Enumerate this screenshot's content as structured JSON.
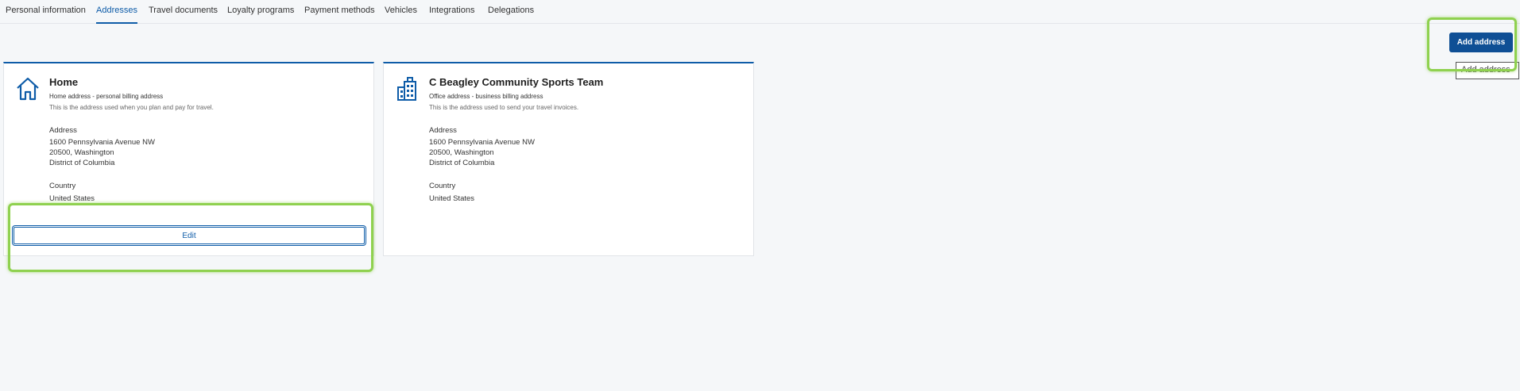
{
  "tabs": [
    {
      "label": "Personal information"
    },
    {
      "label": "Addresses",
      "active": true
    },
    {
      "label": "Travel documents"
    },
    {
      "label": "Loyalty programs"
    },
    {
      "label": "Payment methods"
    },
    {
      "label": "Vehicles"
    },
    {
      "label": "Integrations"
    },
    {
      "label": "Delegations"
    }
  ],
  "toolbar": {
    "add_address_label": "Add address",
    "tooltip_text": "Add address"
  },
  "cards": [
    {
      "icon": "home-icon",
      "title": "Home",
      "subtitle": "Home address - personal billing address",
      "description": "This is the address used when you plan and pay for travel.",
      "address_label": "Address",
      "address_line1": "1600 Pennsylvania Avenue NW",
      "address_line2": "20500, Washington",
      "address_line3": "District of Columbia",
      "country_label": "Country",
      "country_value": "United States",
      "edit_label": "Edit"
    },
    {
      "icon": "office-building-icon",
      "title": "C Beagley Community Sports Team",
      "subtitle": "Office address - business billing address",
      "description": "This is the address used to send your travel invoices.",
      "address_label": "Address",
      "address_line1": "1600 Pennsylvania Avenue NW",
      "address_line2": "20500, Washington",
      "address_line3": "District of Columbia",
      "country_label": "Country",
      "country_value": "United States"
    }
  ],
  "colors": {
    "accent": "#0e5ca8",
    "primary_button": "#0f4f95",
    "highlight": "#8fd14f",
    "background": "#f5f7f9"
  }
}
